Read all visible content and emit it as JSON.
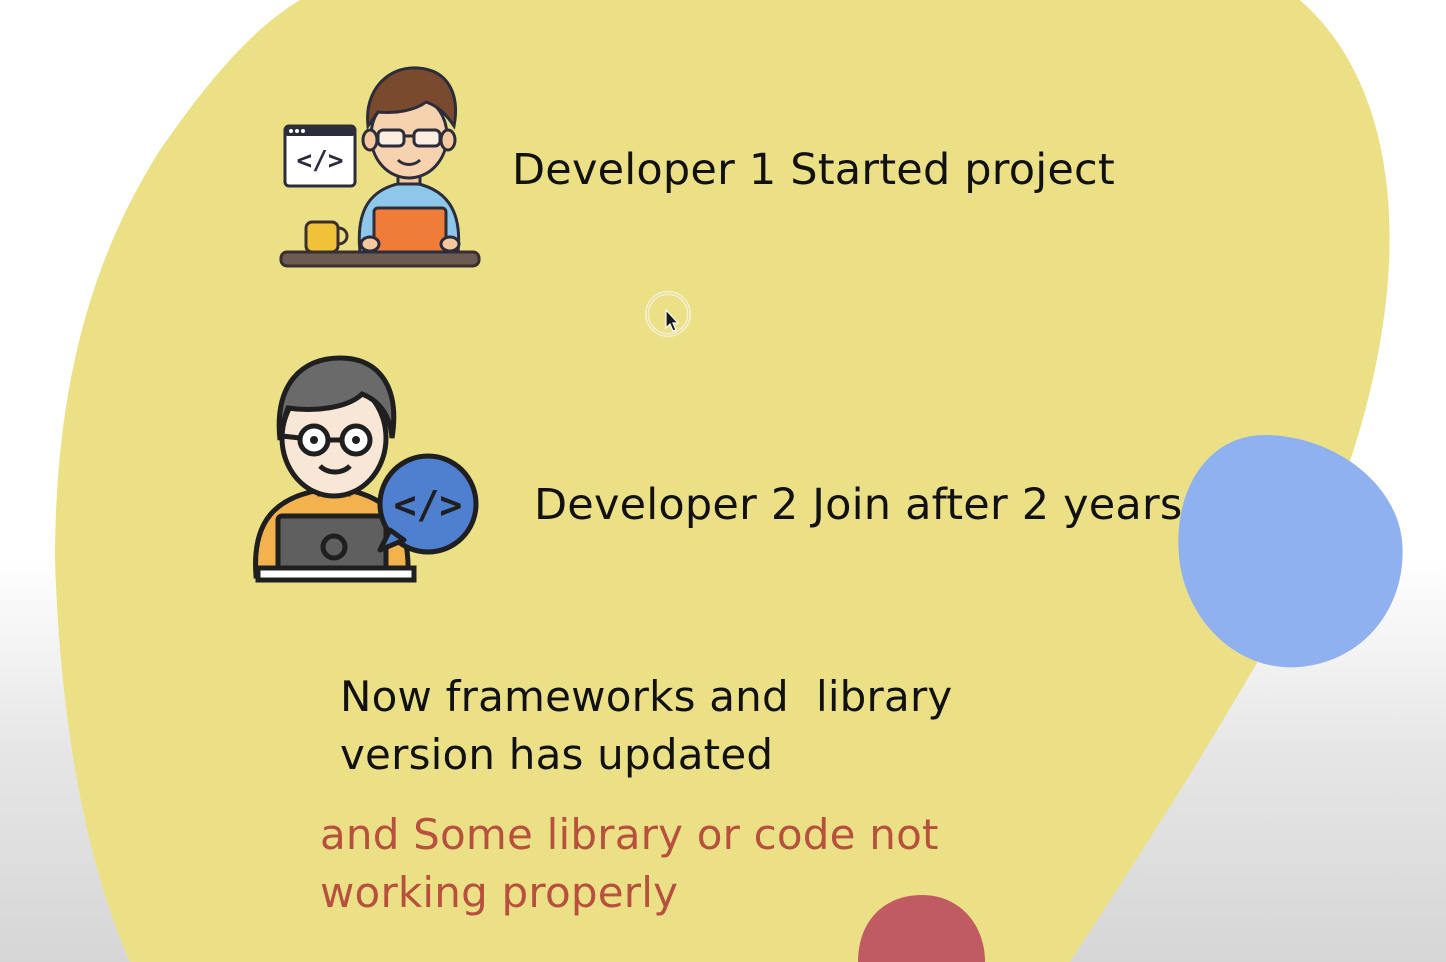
{
  "slide": {
    "developer1_text": "Developer 1 Started project",
    "developer2_text": "Developer 2 Join after 2 years",
    "update_text_line1": "Now frameworks and  library",
    "update_text_line2": "version has updated",
    "issue_text_line1": "and Some library or code not",
    "issue_text_line2": "working properly"
  },
  "icons": {
    "developer1": "developer-with-laptop-and-code-window-icon",
    "developer2": "developer-with-laptop-and-code-bubble-icon",
    "cursor": "mouse-pointer-icon"
  },
  "colors": {
    "yellow_blob": "#ece087",
    "blue_blob": "#8fb1f0",
    "red_blob": "#c05a63",
    "text": "#111111",
    "issue_text": "#b8503e"
  }
}
